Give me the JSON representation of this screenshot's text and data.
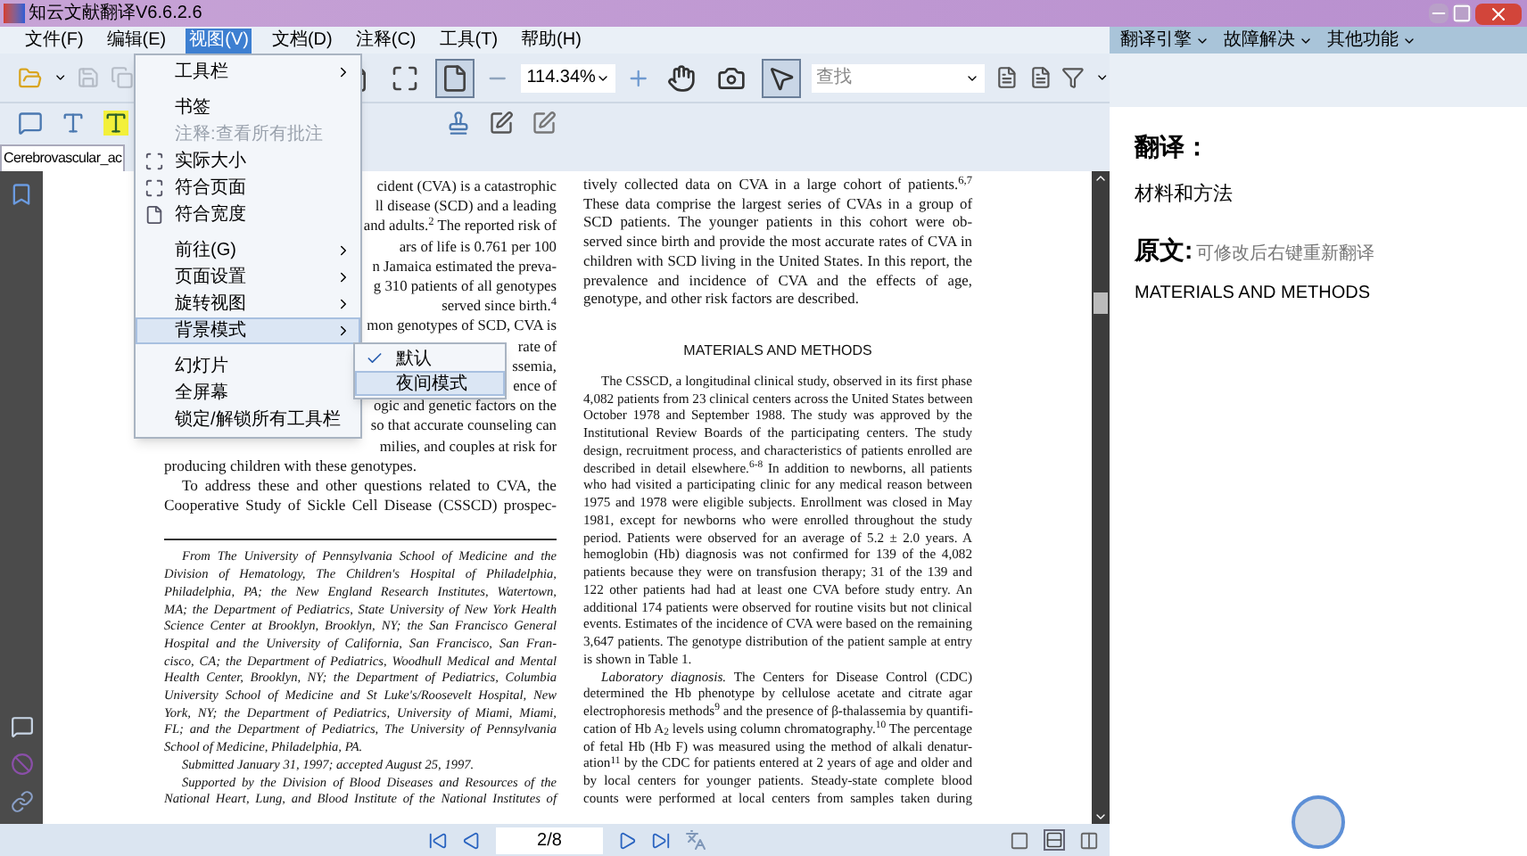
{
  "window": {
    "title": "知云文献翻译V6.6.2.6"
  },
  "menu_bar": [
    {
      "label": "文件(F)",
      "selected": false
    },
    {
      "label": "编辑(E)",
      "selected": false
    },
    {
      "label": "视图(V)",
      "selected": true
    },
    {
      "label": "文档(D)",
      "selected": false
    },
    {
      "label": "注释(C)",
      "selected": false
    },
    {
      "label": "工具(T)",
      "selected": false
    },
    {
      "label": "帮助(H)",
      "selected": false
    }
  ],
  "view_menu": [
    {
      "label": "工具栏",
      "kind": "submenu",
      "disabled": false,
      "highlighted": false
    },
    {
      "label": "书签",
      "kind": "command",
      "disabled": false,
      "highlighted": false
    },
    {
      "label": "注释:查看所有批注",
      "kind": "command",
      "disabled": true,
      "highlighted": false
    },
    {
      "label": "实际大小",
      "kind": "icon_command",
      "disabled": false,
      "highlighted": false
    },
    {
      "label": "符合页面",
      "kind": "icon_command",
      "disabled": false,
      "highlighted": false
    },
    {
      "label": "符合宽度",
      "kind": "icon_command",
      "disabled": false,
      "highlighted": false
    },
    {
      "label": "前往(G)",
      "kind": "submenu",
      "disabled": false,
      "highlighted": false
    },
    {
      "label": "页面设置",
      "kind": "submenu",
      "disabled": false,
      "highlighted": false
    },
    {
      "label": "旋转视图",
      "kind": "submenu",
      "disabled": false,
      "highlighted": false
    },
    {
      "label": "背景模式",
      "kind": "submenu",
      "disabled": false,
      "highlighted": true
    },
    {
      "label": "幻灯片",
      "kind": "command",
      "disabled": false,
      "highlighted": false
    },
    {
      "label": "全屏幕",
      "kind": "command",
      "disabled": false,
      "highlighted": false
    },
    {
      "label": "锁定/解锁所有工具栏",
      "kind": "command",
      "disabled": false,
      "highlighted": false
    }
  ],
  "background_submenu": [
    {
      "label": "默认",
      "checked": true,
      "highlighted": false
    },
    {
      "label": "夜间模式",
      "checked": false,
      "highlighted": true
    }
  ],
  "view_buttons": [
    {
      "selected": false
    },
    {
      "selected": false
    },
    {
      "selected": true
    }
  ],
  "zoom_field": {
    "value": "114.34%"
  },
  "tool_buttons": [
    {
      "selected": false
    },
    {
      "selected": false
    },
    {
      "selected": true
    }
  ],
  "search_field": {
    "placeholder": "查找"
  },
  "document_tab": {
    "label": "Cerebrovascular_ac"
  },
  "left_column": {
    "fragments": [
      "cident (CVA) is a catastrophic",
      "ll disease (SCD) and a leading",
      "and adults.$^{2}$ The reported risk of",
      "ars of life is 0.761 per 100",
      "n Jamaica estimated the preva-",
      "g 310 patients of all genotypes",
      "served since birth.$^{4}$",
      "mon genotypes of SCD, CVA is",
      "rate of",
      "ssemia,",
      "ence of",
      "ogic and genetic factors on the",
      "so that accurate counseling can",
      "milies, and couples at risk for"
    ],
    "paragraphs": [
      {
        "indented": false,
        "continues": false,
        "lines": [
          "producing children with these genotypes."
        ]
      },
      {
        "indented": true,
        "continues": true,
        "lines": [
          "To address these and other questions related to CVA, the",
          "Cooperative Study of Sickle Cell Disease (CSSCD) prospec-"
        ]
      }
    ],
    "footnotes": [
      {
        "indented": true,
        "continues": false,
        "lines": [
          "From The University of Pennsylvania School of Medicine and the",
          "Division of Hematology, The Children's Hospital of Philadelphia,",
          "Philadelphia, PA; the New England Research Institutes, Watertown,",
          "MA; the Department of Pediatrics, State University of New York Health",
          "Science Center at Brooklyn, Brooklyn, NY; the San Francisco General",
          "Hospital and the University of California, San Francisco, San Fran-",
          "cisco, CA; the Department of Pediatrics, Woodhull Medical and Mental",
          "Health Center, Brooklyn, NY; the Department of Pediatrics, Columbia",
          "University School of Medicine and St Luke's/Roosevelt Hospital, New",
          "York, NY; the Department of Pediatrics, University of Miami, Miami,",
          "FL; and the Department of Pediatrics, The University of Pennsylvania",
          "School of Medicine, Philadelphia, PA."
        ]
      },
      {
        "indented": true,
        "continues": false,
        "lines": [
          "Submitted January 31, 1997; accepted August 25, 1997."
        ]
      },
      {
        "indented": true,
        "continues": true,
        "lines": [
          "Supported by the Division of Blood Diseases and Resources of the",
          "National Heart, Lung, and Blood Institute of the National Institutes of"
        ]
      }
    ]
  },
  "right_column": {
    "intro": {
      "indented": false,
      "continues": false,
      "lines": [
        "tively collected data on CVA in a large cohort of patients.$^{6,7}$",
        "These data comprise the largest series of CVAs in a group of",
        "SCD patients. The younger patients in this cohort were ob-",
        "served since birth and provide the most accurate rates of CVA in",
        "children with SCD living in the United States. In this report, the",
        "prevalence and incidence of CVA and the effects of age,",
        "genotype, and other risk factors are described."
      ]
    },
    "heading": "MATERIALS AND METHODS",
    "paragraphs": [
      {
        "indented": true,
        "continues": false,
        "lines": [
          "The CSSCD, a longitudinal clinical study, observed in its first phase",
          "4,082 patients from 23 clinical centers across the United States between",
          "October 1978 and September 1988. The study was approved by the",
          "Institutional Review Boards of the participating centers. The study",
          "design, recruitment process, and characteristics of patients enrolled are",
          "described in detail elsewhere.$^{6-8}$ In addition to newborns, all patients",
          "who had visited a participating clinic for any medical reason between",
          "1975 and 1978 were eligible subjects. Enrollment was closed in May",
          "1981, except for newborns who were enrolled throughout the study",
          "period. Patients were observed for an average of 5.2 ± 2.0 years. A",
          "hemoglobin (Hb) diagnosis was not confirmed for 139 of the 4,082",
          "patients because they were on transfusion therapy; 31 of the 139 and",
          "122 other patients had had at least one CVA before study entry. An",
          "additional 174 patients were observed for routine visits but not clinical",
          "events. Estimates of the incidence of CVA were based on the remaining",
          "3,647 patients. The genotype distribution of the patient sample at entry",
          "is shown in Table 1."
        ]
      },
      {
        "indented": true,
        "continues": true,
        "lines": [
          "*Laboratory diagnosis.*  The Centers for Disease Control (CDC)",
          "determined the Hb phenotype by cellulose acetate and citrate agar",
          "electrophoresis methods$^{9}$ and the presence of β-thalassemia by quantifi-",
          "cation of Hb A$_{2}$ levels using column chromatography.$^{10}$ The percentage",
          "of fetal Hb (Hb F) was measured using the method of alkali denatur-",
          "ation$^{11}$ by the CDC for patients entered at 2 years of age and older and",
          "by local centers for younger patients. Steady-state complete blood",
          "counts were performed at local centers from samples taken during"
        ]
      }
    ]
  },
  "translation_panel": {
    "menu": [
      "翻译引擎",
      "故障解决",
      "其他功能"
    ],
    "translation_heading": "翻译：",
    "translation": "材料和方法",
    "source_heading": "原文:",
    "source_hint": "可修改后右键重新翻译",
    "source": "MATERIALS AND METHODS"
  },
  "status_bar": {
    "page": "2/8"
  }
}
